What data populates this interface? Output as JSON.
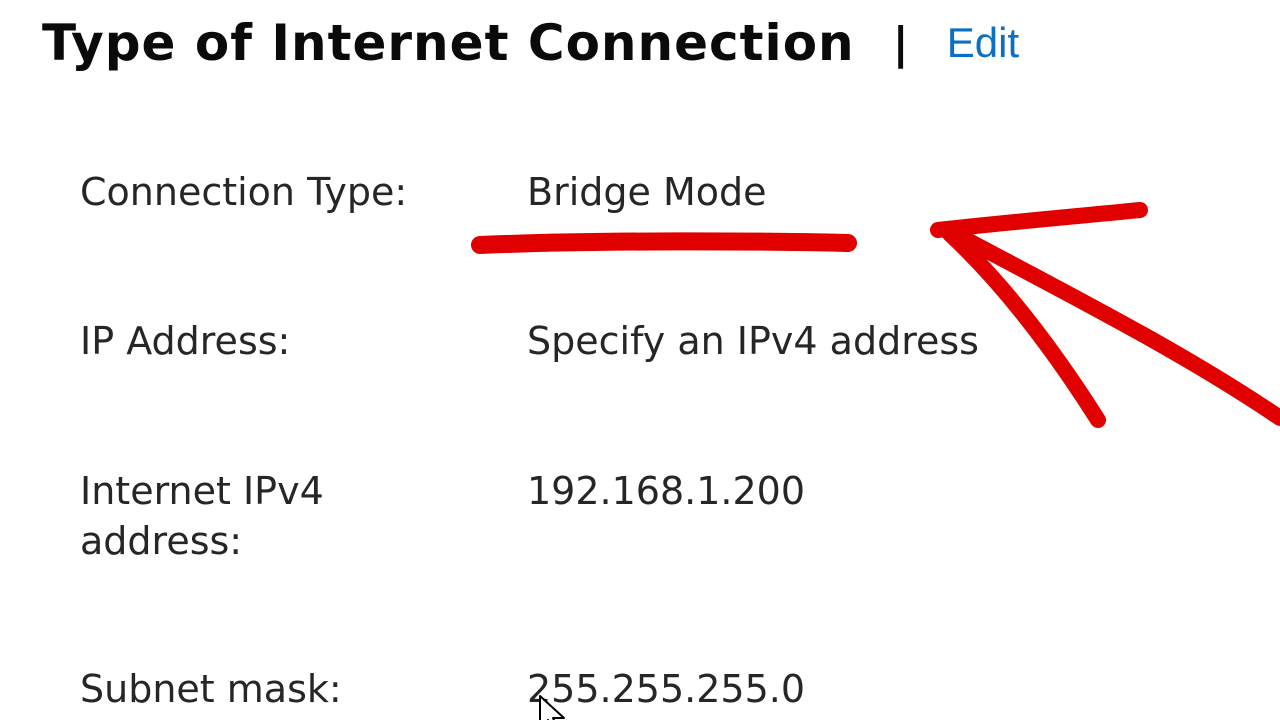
{
  "header": {
    "title": "Type of Internet Connection",
    "separator": "|",
    "edit_label": "Edit"
  },
  "fields": [
    {
      "label": "Connection Type:",
      "value": "Bridge Mode"
    },
    {
      "label": "IP Address:",
      "value": "Specify an IPv4 address"
    },
    {
      "label": "Internet IPv4 address:",
      "value": "192.168.1.200"
    },
    {
      "label": "Subnet mask:",
      "value": "255.255.255.0"
    }
  ],
  "colors": {
    "link": "#0b6fc5",
    "annotation": "#e00000",
    "text": "#262626"
  },
  "icons": [
    "mouse-pointer-icon"
  ]
}
